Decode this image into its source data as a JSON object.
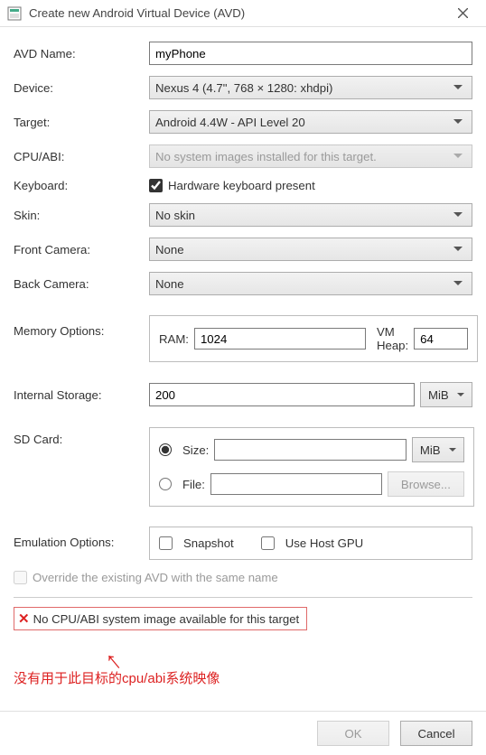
{
  "window": {
    "title": "Create new Android Virtual Device (AVD)"
  },
  "labels": {
    "avd_name": "AVD Name:",
    "device": "Device:",
    "target": "Target:",
    "cpu_abi": "CPU/ABI:",
    "keyboard": "Keyboard:",
    "skin": "Skin:",
    "front_camera": "Front Camera:",
    "back_camera": "Back Camera:",
    "memory_options": "Memory Options:",
    "internal_storage": "Internal Storage:",
    "sd_card": "SD Card:",
    "emulation_options": "Emulation Options:"
  },
  "values": {
    "avd_name": "myPhone",
    "device": "Nexus 4 (4.7\", 768 × 1280: xhdpi)",
    "target": "Android 4.4W - API Level 20",
    "cpu_abi": "No system images installed for this target.",
    "keyboard_checkbox_label": "Hardware keyboard present",
    "keyboard_checked": true,
    "skin": "No skin",
    "front_camera": "None",
    "back_camera": "None",
    "ram_label": "RAM:",
    "ram_value": "1024",
    "vm_heap_label": "VM Heap:",
    "vm_heap_value": "64",
    "internal_storage_value": "200",
    "internal_storage_unit": "MiB",
    "sd_size_label": "Size:",
    "sd_size_value": "",
    "sd_size_unit": "MiB",
    "sd_file_label": "File:",
    "sd_file_value": "",
    "browse_label": "Browse...",
    "snapshot_label": "Snapshot",
    "use_host_gpu_label": "Use Host GPU",
    "override_label": "Override the existing AVD with the same name",
    "error_text": "No CPU/ABI system image available for this target",
    "annotation": "没有用于此目标的cpu/abi系统映像"
  },
  "buttons": {
    "ok": "OK",
    "cancel": "Cancel"
  }
}
